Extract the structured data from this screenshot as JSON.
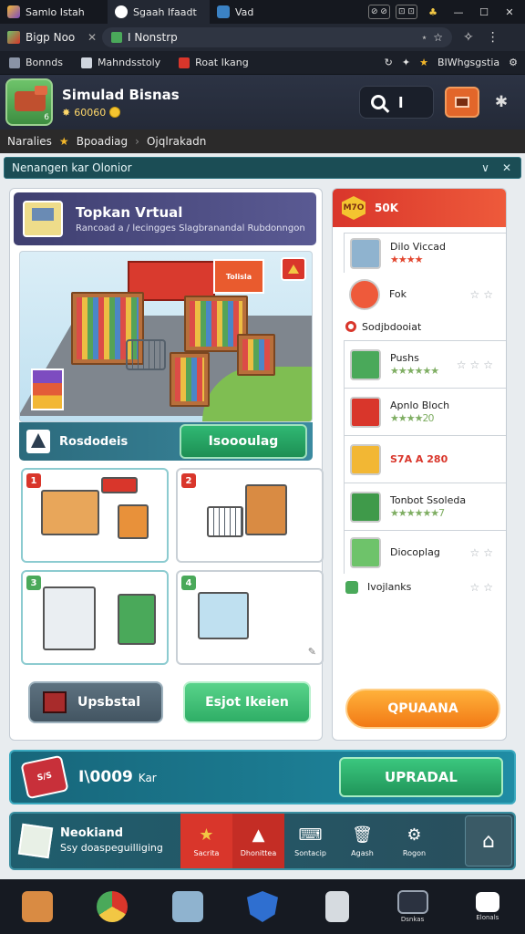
{
  "browser": {
    "tabs": [
      {
        "label": "Samlo Istah",
        "icon": "game-cube-icon"
      },
      {
        "label": "Sgaah Ifaadt",
        "icon": "github-icon"
      },
      {
        "label": "Vad",
        "icon": "vscode-icon"
      }
    ],
    "window_controls": {
      "box1": "⊘ ⊘",
      "box2": "⊡ ⊡"
    },
    "address": {
      "tab_label": "Bigp Noo",
      "url": "I Nonstrp"
    },
    "bookmarks": [
      {
        "label": "Bonnds"
      },
      {
        "label": "Mahndsstoly"
      },
      {
        "label": "Roat Ikang"
      }
    ],
    "bookmark_right": "BIWhgsgstia"
  },
  "app": {
    "title": "Simulad Bisnas",
    "coins": "60060",
    "search_value": "l",
    "breadcrumb": [
      "Naralies",
      "Bpoadiag",
      "Ojqlrakadn"
    ]
  },
  "panel": {
    "title": "Nenangen kar Olonior"
  },
  "hero": {
    "title": "Topkan Vrtual",
    "subtitle": "Rancoad a / lecingges Slagbranandal Rubdonngon",
    "scene_sign": "Tolisla",
    "bar_label": "Rosdodeis",
    "bar_button": "Isoooulag"
  },
  "tiles": [
    "1",
    "2",
    "3",
    "4"
  ],
  "left_buttons": {
    "upgrade": "Upsbstal",
    "start": "Esjot Ikeien"
  },
  "rank": {
    "header": "50K",
    "header_badge": "M7O",
    "items": [
      {
        "name": "Dilo Viccad",
        "stars": "★★★★",
        "hollow": ""
      },
      {
        "name": "Fok",
        "stars": "",
        "hollow": "☆☆"
      },
      {
        "name": "Sodjbdooiat",
        "stars": "",
        "hollow": ""
      },
      {
        "name": "Pushs",
        "stars": "★★★★★★",
        "hollow": "☆☆☆"
      },
      {
        "name": "Apnlo Bloch",
        "stars": "★★★★20",
        "hollow": ""
      },
      {
        "name": "S7A A 280",
        "stars": "",
        "hollow": ""
      },
      {
        "name": "Tonbot Ssoleda",
        "stars": "★★★★★★7",
        "hollow": ""
      },
      {
        "name": "Diocoplag",
        "stars": "",
        "hollow": "☆☆"
      },
      {
        "name": "Ivojlanks",
        "stars": "",
        "hollow": "☆☆"
      }
    ],
    "cta": "QPUAANA"
  },
  "promo": {
    "tag": "S/S",
    "label": "I\\0009",
    "label_small": "Kar",
    "cta": "UPRADAL"
  },
  "navstrip": {
    "title": "Neokiand",
    "subtitle": "Ssy doaspeguilliging",
    "items": [
      {
        "label": "Sacrita",
        "icon": "star-icon"
      },
      {
        "label": "Dhonittea",
        "icon": "triangle-icon"
      },
      {
        "label": "Sontacip",
        "icon": "laptop-icon"
      },
      {
        "label": "Agash",
        "icon": "basket-icon"
      },
      {
        "label": "Rogon",
        "icon": "gear-icon"
      }
    ]
  },
  "dock": [
    {
      "name": "store-icon",
      "label": ""
    },
    {
      "name": "chrome-icon",
      "label": ""
    },
    {
      "name": "notes-icon",
      "label": ""
    },
    {
      "name": "shield-icon",
      "label": ""
    },
    {
      "name": "file-icon",
      "label": ""
    },
    {
      "name": "terminal-icon",
      "label": "Dsnkas"
    },
    {
      "name": "menu-icon",
      "label": "Elonals"
    }
  ]
}
